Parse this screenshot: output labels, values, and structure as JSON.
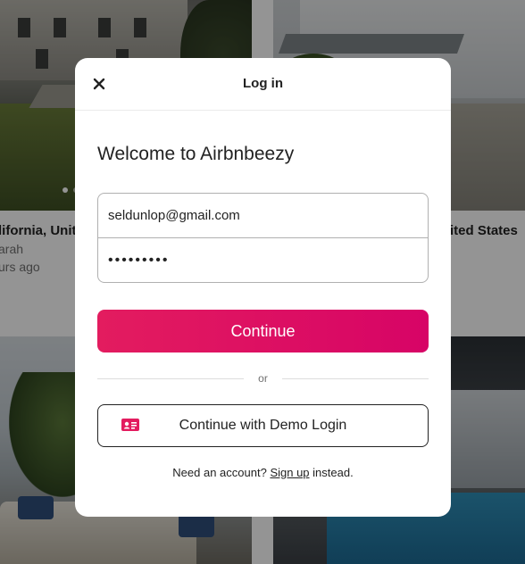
{
  "background": {
    "listing_left": {
      "location": "lifornia, Unit",
      "host": "arah",
      "time": "urs ago"
    },
    "listing_right": {
      "location": "ited States"
    }
  },
  "modal": {
    "title": "Log in",
    "close_icon": "close-icon",
    "welcome": "Welcome to Airbnbeezy",
    "email_value": "seldunlop@gmail.com",
    "password_value": "•••••••••",
    "continue_label": "Continue",
    "divider_text": "or",
    "demo_label": "Continue with Demo Login",
    "demo_icon": "id-card-icon",
    "signup_prefix": "Need an account? ",
    "signup_link": "Sign up",
    "signup_suffix": " instead."
  },
  "colors": {
    "accent": "#e31c5f",
    "accent_end": "#d70466",
    "text": "#222222",
    "muted": "#717171"
  }
}
